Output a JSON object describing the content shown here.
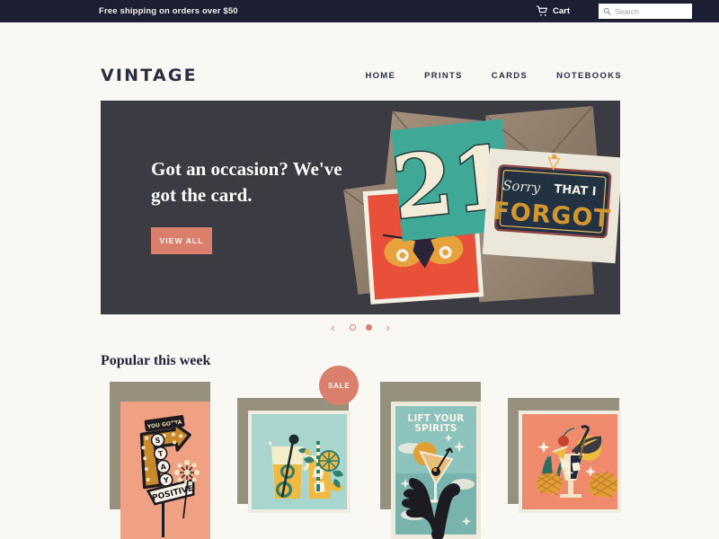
{
  "topbar": {
    "message": "Free shipping on orders over $50",
    "cart_label": "Cart",
    "cart_icon": "shopping-cart-icon",
    "search_icon": "search-icon",
    "search_placeholder": "Search",
    "search_value": "",
    "bg_color": "#1c1f33"
  },
  "header": {
    "logo": "VINTAGE",
    "nav": [
      {
        "label": "HOME"
      },
      {
        "label": "PRINTS"
      },
      {
        "label": "CARDS"
      },
      {
        "label": "NOTEBOOKS"
      }
    ]
  },
  "hero": {
    "title": "Got an occasion? We've got the card.",
    "button_label": "VIEW ALL",
    "button_color": "#d97f6c",
    "bg_color": "#3b3b44",
    "photo_alt": "greeting-cards-with-kraft-envelopes",
    "cards_in_photo": [
      {
        "text": "21",
        "bg": "#3fa897"
      },
      {
        "text": "Sorry THAT I FORGOT",
        "bg": "#ece7db"
      },
      {
        "text": "butterfly",
        "bg": "#e8503a"
      }
    ]
  },
  "carousel": {
    "prev_icon": "chevron-left-icon",
    "next_icon": "chevron-right-icon",
    "prev_glyph": "‹",
    "next_glyph": "›",
    "slide_count": 2,
    "active_slide": 2,
    "accent_color": "#d97f6c"
  },
  "popular": {
    "title": "Popular this week",
    "products": [
      {
        "name": "you-gotta-stay-positive-card",
        "shape": "portrait",
        "bg": "#f0a183",
        "caption": "YOU GOTTA STAY POSITIVE",
        "badge": null
      },
      {
        "name": "lemonade-pitcher-card",
        "shape": "square",
        "bg": "#a8d5cd",
        "caption": "",
        "badge": "SALE"
      },
      {
        "name": "lift-your-spirits-card",
        "shape": "portrait",
        "bg": "#8cc4bd",
        "caption": "LIFT YOUR SPIRITS",
        "badge": null
      },
      {
        "name": "tropical-cocktail-card",
        "shape": "square",
        "bg": "#ef8b6c",
        "caption": "",
        "badge": null
      }
    ]
  }
}
